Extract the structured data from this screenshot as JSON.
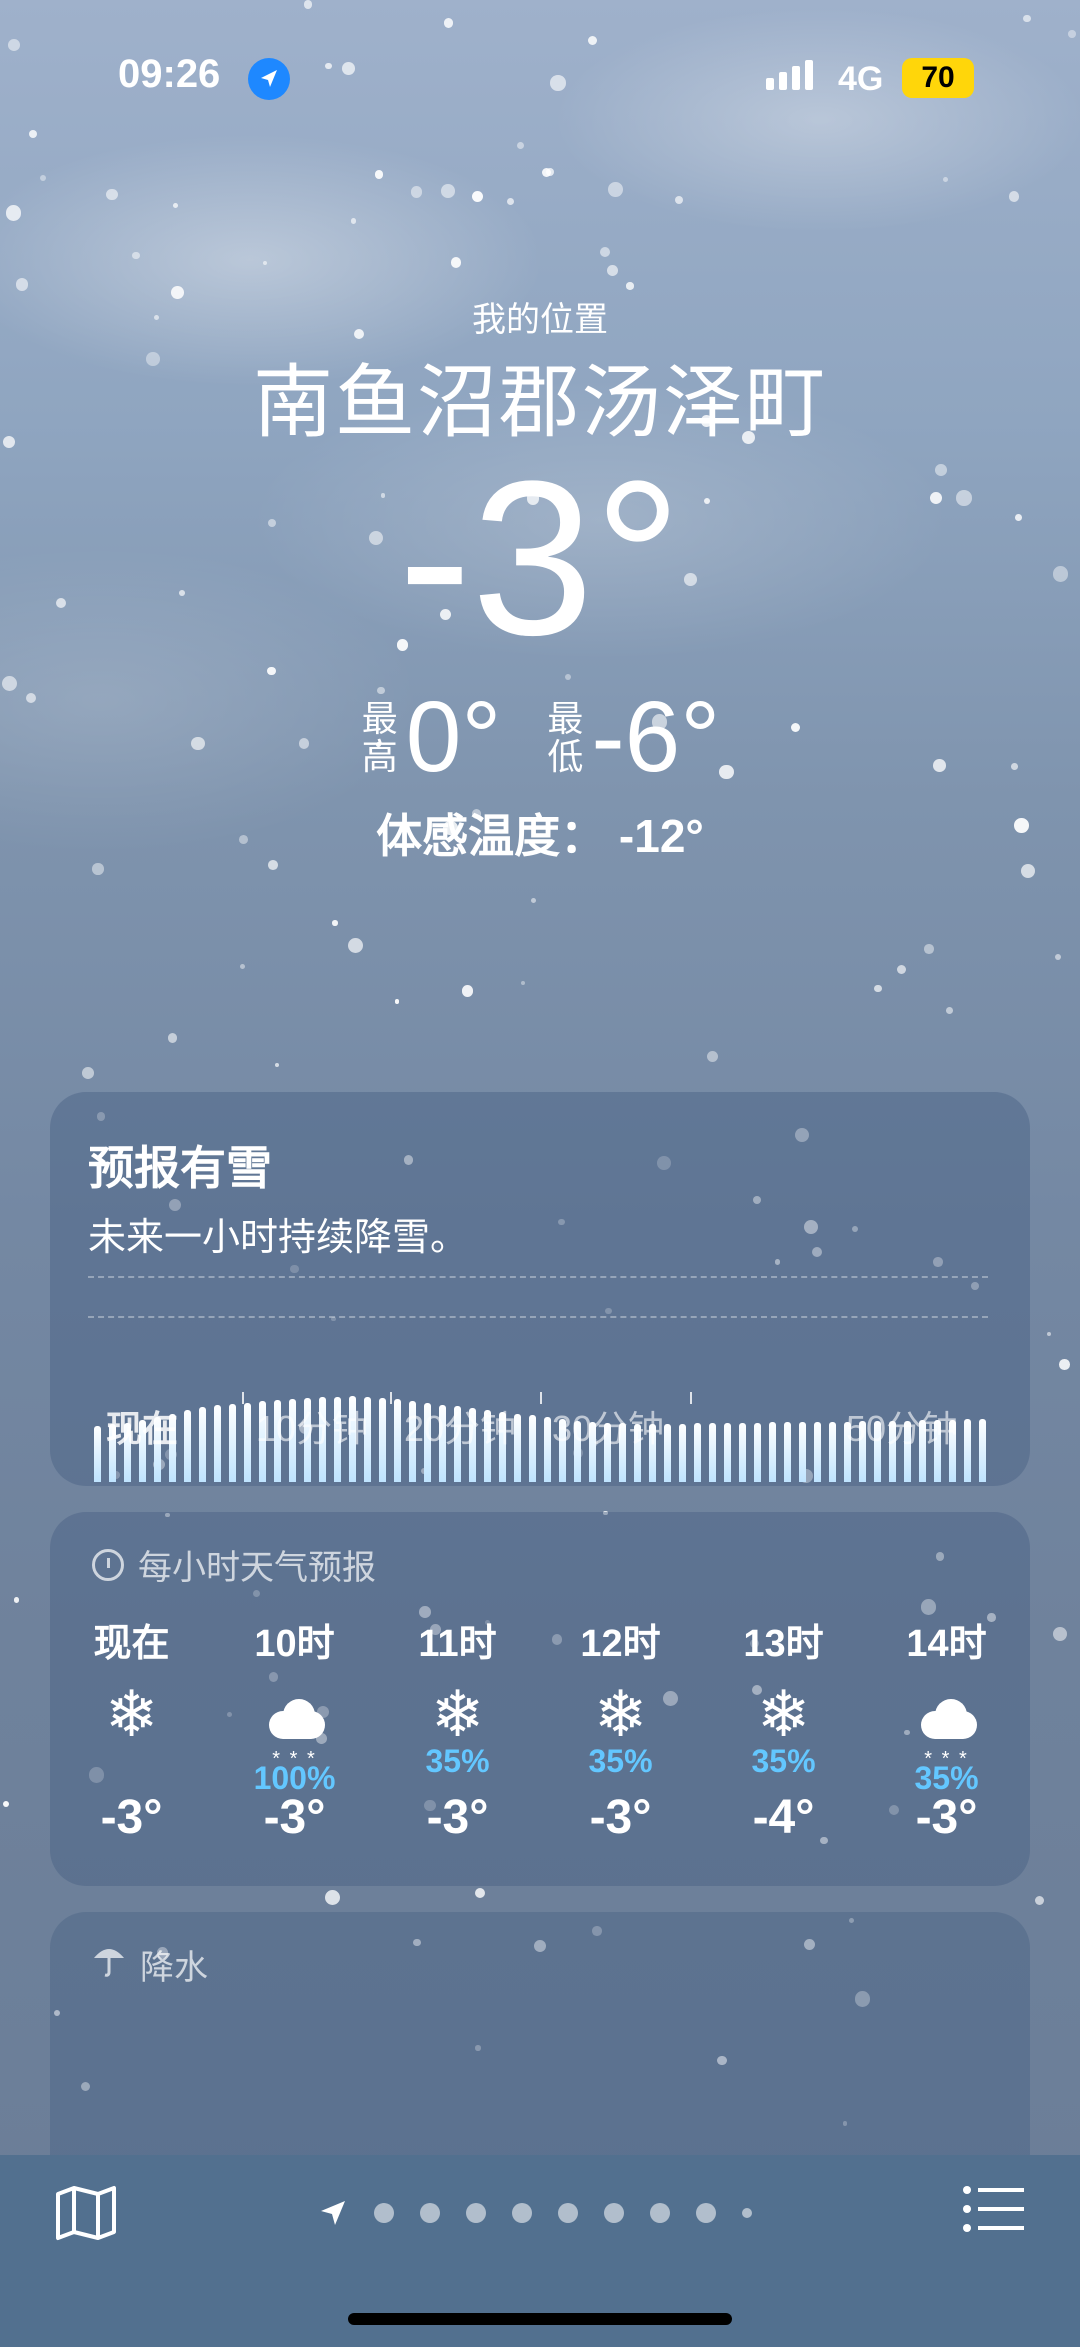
{
  "status_bar": {
    "time": "09:26",
    "network": "4G",
    "battery": "70"
  },
  "header": {
    "my_location": "我的位置",
    "city": "南鱼沼郡汤泽町",
    "temperature": "-3°",
    "high_label": "最高",
    "high": "0°",
    "low_label": "最低",
    "low": "-6°",
    "feels_like": "体感温度： -12°"
  },
  "precip_card": {
    "title": "预报有雪",
    "subtitle": "未来一小时持续降雪。",
    "axis_labels": [
      "现在",
      "10分钟",
      "20分钟",
      "30分钟",
      "50分钟"
    ],
    "intensity": [
      0.62,
      0.64,
      0.66,
      0.69,
      0.72,
      0.76,
      0.8,
      0.83,
      0.85,
      0.87,
      0.88,
      0.9,
      0.91,
      0.92,
      0.93,
      0.94,
      0.94,
      0.95,
      0.94,
      0.93,
      0.92,
      0.9,
      0.88,
      0.86,
      0.84,
      0.82,
      0.8,
      0.78,
      0.76,
      0.74,
      0.72,
      0.7,
      0.68,
      0.67,
      0.66,
      0.65,
      0.64,
      0.64,
      0.64,
      0.64,
      0.65,
      0.65,
      0.66,
      0.66,
      0.66,
      0.67,
      0.67,
      0.67,
      0.67,
      0.67,
      0.67,
      0.68,
      0.68,
      0.68,
      0.68,
      0.69,
      0.69,
      0.69,
      0.7,
      0.7
    ]
  },
  "hourly_card": {
    "header": "每小时天气预报",
    "hours": [
      {
        "time": "现在",
        "icon": "snowflake-icon",
        "pop": "",
        "temp": "-3°"
      },
      {
        "time": "10时",
        "icon": "cloud-snow-icon",
        "pop": "100%",
        "temp": "-3°"
      },
      {
        "time": "11时",
        "icon": "snowflake-icon",
        "pop": "35%",
        "temp": "-3°"
      },
      {
        "time": "12时",
        "icon": "snowflake-icon",
        "pop": "35%",
        "temp": "-3°"
      },
      {
        "time": "13时",
        "icon": "snowflake-icon",
        "pop": "35%",
        "temp": "-4°"
      },
      {
        "time": "14时",
        "icon": "cloud-snow-icon",
        "pop": "35%",
        "temp": "-3°"
      }
    ]
  },
  "precip_section": {
    "header": "降水"
  },
  "toolbar": {
    "page_count": 8
  }
}
